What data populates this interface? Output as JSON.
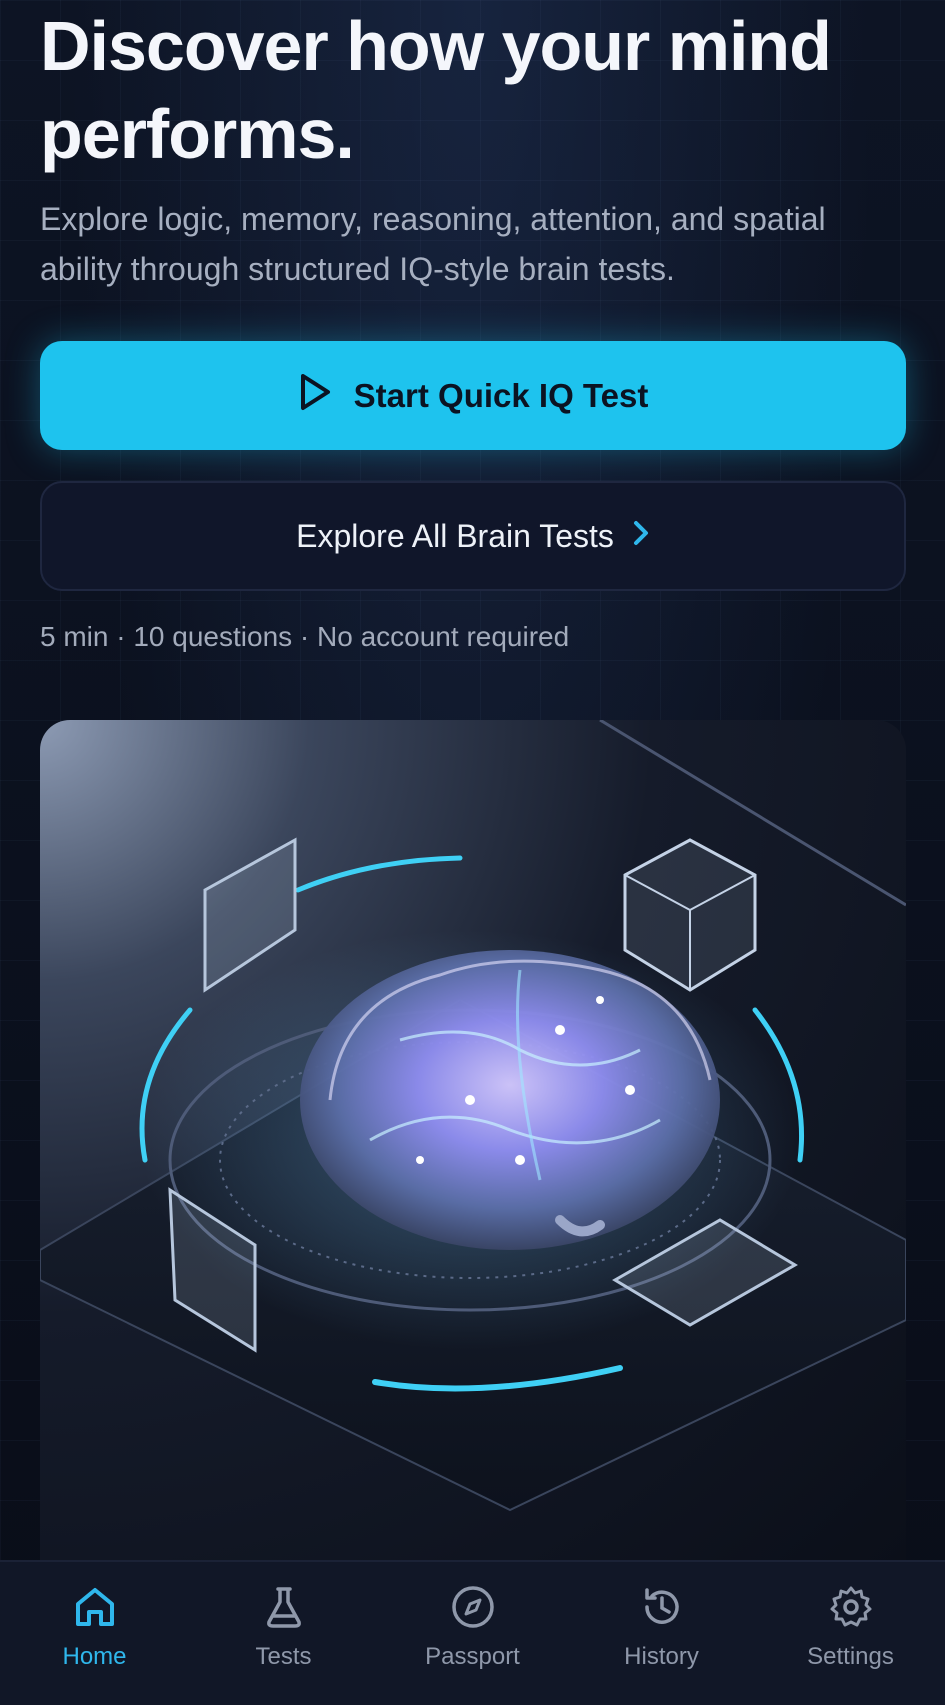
{
  "hero": {
    "title": "Discover how your mind performs.",
    "subtitle": "Explore logic, memory, reasoning, attention, and spatial ability through structured IQ-style brain tests."
  },
  "actions": {
    "primary_label": "Start Quick IQ Test",
    "secondary_label": "Explore All Brain Tests"
  },
  "meta": "5 min · 10 questions · No account required",
  "colors": {
    "accent": "#1ec3ee",
    "background": "#0a0f1c",
    "nav_active": "#2fb7ec",
    "nav_inactive": "#8f98aa"
  },
  "nav": {
    "items": [
      {
        "label": "Home",
        "icon": "home-icon",
        "active": true
      },
      {
        "label": "Tests",
        "icon": "flask-icon",
        "active": false
      },
      {
        "label": "Passport",
        "icon": "compass-icon",
        "active": false
      },
      {
        "label": "History",
        "icon": "history-icon",
        "active": false
      },
      {
        "label": "Settings",
        "icon": "gear-icon",
        "active": false
      }
    ]
  }
}
